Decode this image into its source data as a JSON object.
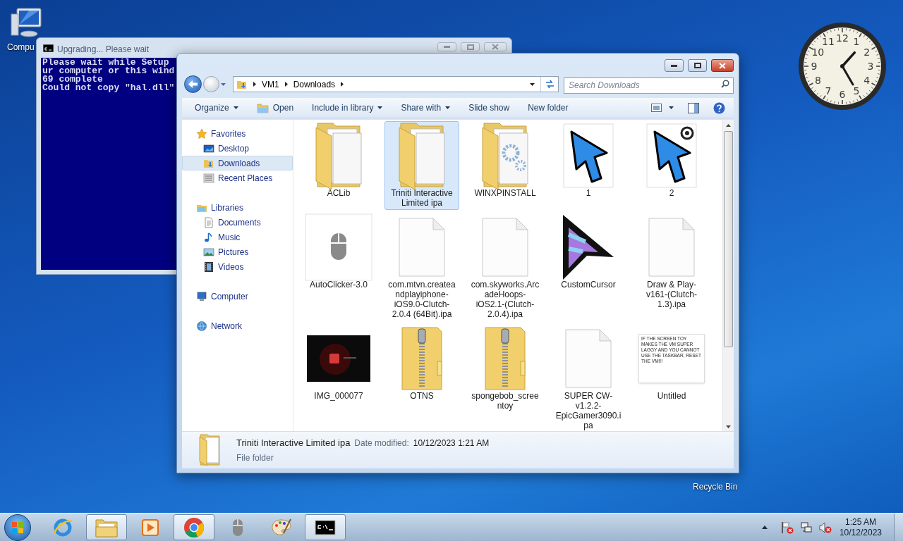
{
  "desktop_icons": [
    {
      "label": "Compu"
    },
    {
      "label": "Recycle Bin"
    }
  ],
  "clock_gadget": {
    "numbers": [
      "12",
      "11",
      "1",
      "10",
      "2",
      "9",
      "3",
      "8",
      "4",
      "7",
      "5",
      "6"
    ]
  },
  "console_window": {
    "title": "Upgrading... Please wait",
    "lines": [
      "Please wait while Setup",
      "ur computer or this wind",
      "69 complete",
      "Could not copy \"hal.dll\""
    ]
  },
  "explorer": {
    "breadcrumb": [
      "VM1",
      "Downloads"
    ],
    "search": {
      "placeholder": "Search Downloads"
    },
    "toolbar": [
      {
        "label": "Organize",
        "dropdown": true
      },
      {
        "label": "Open",
        "dropdown": false
      },
      {
        "label": "Include in library",
        "dropdown": true
      },
      {
        "label": "Share with",
        "dropdown": true
      },
      {
        "label": "Slide show",
        "dropdown": false
      },
      {
        "label": "New folder",
        "dropdown": false
      }
    ],
    "nav": [
      {
        "label": "Favorites",
        "selected": false,
        "children": [
          {
            "label": "Desktop",
            "selected": false
          },
          {
            "label": "Downloads",
            "selected": true
          },
          {
            "label": "Recent Places",
            "selected": false
          }
        ]
      },
      {
        "label": "Libraries",
        "selected": false,
        "children": [
          {
            "label": "Documents",
            "selected": false
          },
          {
            "label": "Music",
            "selected": false
          },
          {
            "label": "Pictures",
            "selected": false
          },
          {
            "label": "Videos",
            "selected": false
          }
        ]
      },
      {
        "label": "Computer",
        "selected": false
      },
      {
        "label": "Network",
        "selected": false
      }
    ],
    "files": [
      {
        "label": "ACLib",
        "kind": "folder",
        "selected": false
      },
      {
        "label": "Triniti Interactive Limited ipa",
        "kind": "folder",
        "selected": true
      },
      {
        "label": "WINXPINSTALL",
        "kind": "gear_folder",
        "selected": false
      },
      {
        "label": "1",
        "kind": "cursor",
        "selected": false
      },
      {
        "label": "2",
        "kind": "cursor_target",
        "selected": false
      },
      {
        "label": "AutoClicker-3.0",
        "kind": "mouse",
        "selected": false
      },
      {
        "label": "com.mtvn.createandplayiphone-iOS9.0-Clutch-2.0.4 (64Bit).ipa",
        "kind": "file",
        "selected": false
      },
      {
        "label": "com.skyworks.ArcadeHoops-iOS2.1-(Clutch-2.0.4).ipa",
        "kind": "file",
        "selected": false
      },
      {
        "label": "CustomCursor",
        "kind": "custom_cursor",
        "selected": false
      },
      {
        "label": "Draw & Play-v161-(Clutch-1.3).ipa",
        "kind": "file",
        "selected": false
      },
      {
        "label": "IMG_000077",
        "kind": "picture",
        "selected": false
      },
      {
        "label": "OTNS",
        "kind": "zip",
        "selected": false
      },
      {
        "label": "spongebob_screentoy",
        "kind": "zip",
        "selected": false
      },
      {
        "label": "SUPER CW-v1.2.2-EpicGamer3090.ipa",
        "kind": "file",
        "selected": false
      },
      {
        "label": "Untitled",
        "kind": "note",
        "selected": false,
        "thumbnail_text": "IF THE SCREEN TOY MAKES THE VM SUPER LAGGY AND YOU CANNOT USE THE TASKBAR, RESET THE VM!!!"
      }
    ],
    "details": {
      "name": "Triniti Interactive Limited ipa",
      "date_label": "Date modified:",
      "date": "10/12/2023 1:21 AM",
      "type": "File folder"
    }
  },
  "taskbar": {
    "apps": [
      {
        "running": false
      },
      {
        "running": true
      },
      {
        "running": false
      },
      {
        "running": true
      },
      {
        "running": false
      },
      {
        "running": false
      },
      {
        "running": true
      }
    ],
    "time": "1:25 AM",
    "date": "10/12/2023"
  }
}
